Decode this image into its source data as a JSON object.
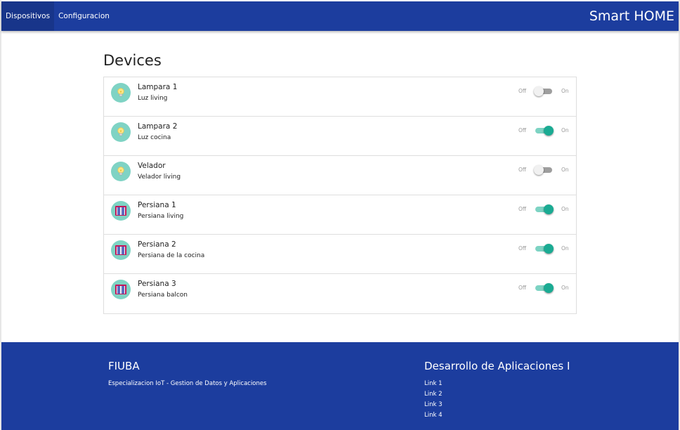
{
  "navbar": {
    "tabs": [
      {
        "label": "Dispositivos",
        "active": true
      },
      {
        "label": "Configuracion",
        "active": false
      }
    ],
    "brand": "Smart HOME",
    "color": "#1c3d9e"
  },
  "main": {
    "title": "Devices",
    "off_label": "Off",
    "on_label": "On",
    "devices": [
      {
        "name": "Lampara 1",
        "description": "Luz living",
        "icon": "lightbulb-icon",
        "state": false
      },
      {
        "name": "Lampara 2",
        "description": "Luz cocina",
        "icon": "lightbulb-icon",
        "state": true
      },
      {
        "name": "Velador",
        "description": "Velador living",
        "icon": "lightbulb-icon",
        "state": false
      },
      {
        "name": "Persiana 1",
        "description": "Persiana living",
        "icon": "window-blind-icon",
        "state": true
      },
      {
        "name": "Persiana 2",
        "description": "Persiana de la cocina",
        "icon": "window-blind-icon",
        "state": true
      },
      {
        "name": "Persiana 3",
        "description": "Persiana balcon",
        "icon": "window-blind-icon",
        "state": true
      }
    ],
    "accent_color": "#1aab93"
  },
  "footer": {
    "left_title": "FIUBA",
    "left_text": "Especializacion IoT - Gestion de Datos y Aplicaciones",
    "right_title": "Desarrollo de Aplicaciones I",
    "links": [
      "Link 1",
      "Link 2",
      "Link 3",
      "Link 4"
    ]
  }
}
